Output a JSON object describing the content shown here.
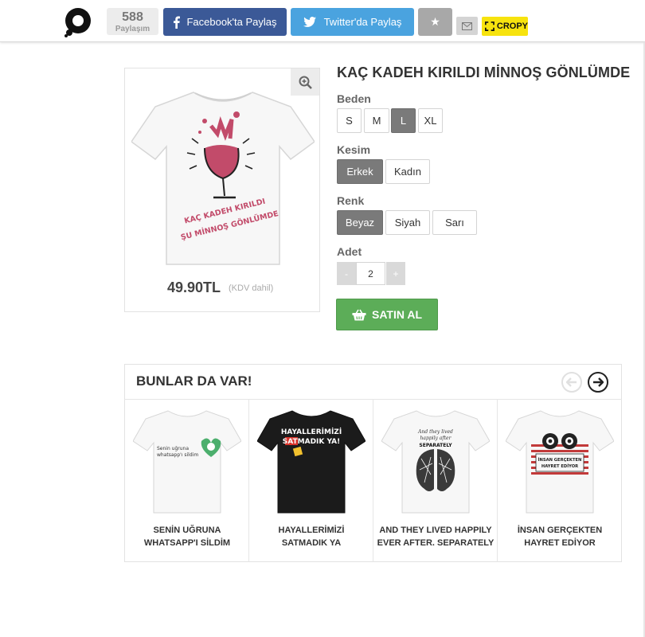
{
  "share_bar": {
    "share_count": "588",
    "share_count_label": "Paylaşım",
    "facebook_label": "Facebook'ta Paylaş",
    "twitter_label": "Twitter'da Paylaş",
    "cropy_label": "CROPY",
    "colors": {
      "facebook": "#3b5997",
      "twitter": "#4aa3df",
      "cropy": "#f7e30e"
    }
  },
  "product": {
    "title": "KAÇ KADEH KIRILDI MİNNOŞ GÖNLÜMDE",
    "print_text_line1": "KAÇ KADEH KIRILDI",
    "print_text_line2": "ŞU MİNNOŞ GÖNLÜMDE",
    "price": "49.90TL",
    "price_note": "(KDV dahil)",
    "size_label": "Beden",
    "sizes": [
      "S",
      "M",
      "L",
      "XL"
    ],
    "selected_size": "L",
    "cut_label": "Kesim",
    "cuts": [
      "Erkek",
      "Kadın"
    ],
    "selected_cut": "Erkek",
    "color_label": "Renk",
    "colors": [
      "Beyaz",
      "Siyah",
      "Sarı"
    ],
    "selected_color": "Beyaz",
    "qty_label": "Adet",
    "qty_minus": "-",
    "qty_plus": "+",
    "quantity": "2",
    "buy_label": "SATIN AL",
    "buy_color": "#5cad58"
  },
  "related": {
    "title": "BUNLAR DA VAR!",
    "items": [
      {
        "name": "SENİN UĞRUNA\nWHATSAPP'I SİLDİM",
        "print_line1": "Senin uğruna",
        "print_line2": "whatsapp'ı sildim"
      },
      {
        "name": "HAYALLERİMİZİ\nSATMADIK YA",
        "print_line1": "HAYALLERİMİZİ",
        "print_line2": "SATMADIK YA!"
      },
      {
        "name": "AND THEY LIVED HAPPILY\nEVER AFTER. SEPARATELY",
        "print_line1": "And they lived",
        "print_line2": "happily after",
        "print_line3": "SEPARATELY"
      },
      {
        "name": "İNSAN GERÇEKTEN\nHAYRET EDİYOR",
        "print_line1": "İNSAN GERÇEKTEN",
        "print_line2": "HAYRET EDİYOR"
      }
    ]
  }
}
